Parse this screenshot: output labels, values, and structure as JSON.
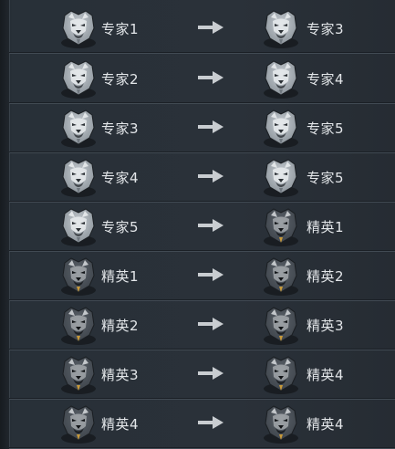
{
  "rows": [
    {
      "from": "专家1",
      "to": "专家3",
      "from_badge": "expert-wolf-badge-icon",
      "to_badge": "expert-wolf-badge-icon"
    },
    {
      "from": "专家2",
      "to": "专家4",
      "from_badge": "expert-wolf-badge-icon",
      "to_badge": "expert-wolf-badge-icon"
    },
    {
      "from": "专家3",
      "to": "专家5",
      "from_badge": "expert-wolf-badge-icon",
      "to_badge": "expert-wolf-badge-icon"
    },
    {
      "from": "专家4",
      "to": "专家5",
      "from_badge": "expert-wolf-badge-icon",
      "to_badge": "expert-wolf-badge-icon"
    },
    {
      "from": "专家5",
      "to": "精英1",
      "from_badge": "expert-wolf-badge-icon",
      "to_badge": "elite-wolf-badge-icon"
    },
    {
      "from": "精英1",
      "to": "精英2",
      "from_badge": "elite-wolf-badge-icon",
      "to_badge": "elite-wolf-badge-icon"
    },
    {
      "from": "精英2",
      "to": "精英3",
      "from_badge": "elite-wolf-badge-icon",
      "to_badge": "elite-wolf-badge-icon"
    },
    {
      "from": "精英3",
      "to": "精英4",
      "from_badge": "elite-wolf-badge-icon",
      "to_badge": "elite-wolf-badge-icon"
    },
    {
      "from": "精英4",
      "to": "精英4",
      "from_badge": "elite-wolf-badge-icon",
      "to_badge": "elite-wolf-badge-icon"
    }
  ],
  "arrow_icon": "right-arrow-icon",
  "colors": {
    "background": "#262c33",
    "divider": "#414a53",
    "text": "#e3e6e9",
    "arrow": "#c9cdd1",
    "expert_badge": "#9ea6ad",
    "elite_badge": "#4a5057",
    "elite_accent": "#c89a3a"
  }
}
